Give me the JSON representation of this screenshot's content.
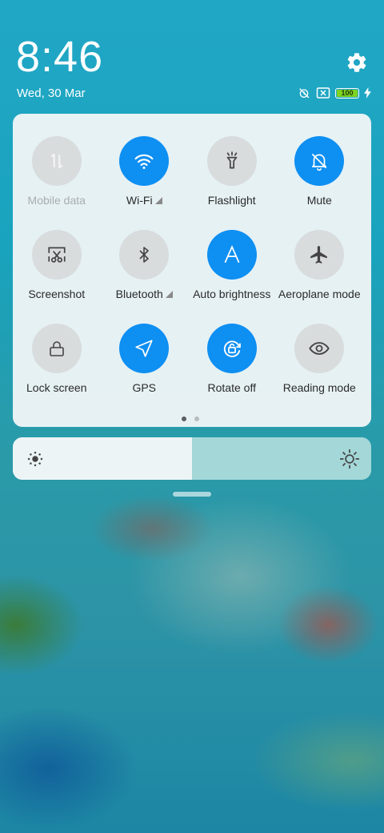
{
  "status_bar": {
    "time": "8:46",
    "date": "Wed, 30 Mar",
    "battery_level": "100",
    "icons": [
      "alarm-off-icon",
      "sim-missing-icon",
      "battery-icon",
      "charging-icon"
    ]
  },
  "settings_icon": "gear-icon",
  "quick_settings": {
    "tiles": [
      {
        "label": "Mobile data",
        "icon": "mobile-data-icon",
        "active": false,
        "disabled": true
      },
      {
        "label": "Wi-Fi",
        "icon": "wifi-icon",
        "active": true
      },
      {
        "label": "Flashlight",
        "icon": "flashlight-icon",
        "active": false
      },
      {
        "label": "Mute",
        "icon": "mute-icon",
        "active": true
      },
      {
        "label": "Screenshot",
        "icon": "screenshot-icon",
        "active": false
      },
      {
        "label": "Bluetooth",
        "icon": "bluetooth-icon",
        "active": false
      },
      {
        "label": "Auto brightness",
        "icon": "auto-brightness-icon",
        "active": true
      },
      {
        "label": "Aeroplane mode",
        "icon": "airplane-icon",
        "active": false
      },
      {
        "label": "Lock screen",
        "icon": "lock-icon",
        "active": false
      },
      {
        "label": "GPS",
        "icon": "gps-icon",
        "active": true
      },
      {
        "label": "Rotate off",
        "icon": "rotate-lock-icon",
        "active": true
      },
      {
        "label": "Reading mode",
        "icon": "eye-icon",
        "active": false
      }
    ],
    "page_count": 2,
    "current_page": 1
  },
  "brightness": {
    "level": 0.5
  },
  "colors": {
    "accent": "#0e8ff2",
    "tile_off": "#d8dcdd",
    "panel": "#f1f6f7"
  }
}
